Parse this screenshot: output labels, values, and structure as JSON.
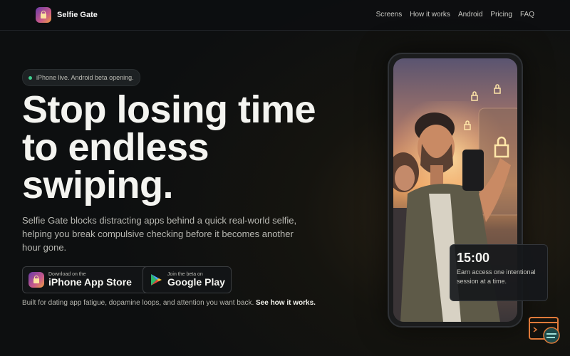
{
  "nav": {
    "brand": "Selfie Gate",
    "links": [
      "Screens",
      "How it works",
      "Android",
      "Pricing",
      "FAQ"
    ]
  },
  "hero": {
    "badge": "iPhone live. Android beta opening.",
    "headline_line1": "Stop losing time",
    "headline_line2": "to endless",
    "headline_line3": "swiping.",
    "subtext": "Selfie Gate blocks distracting apps behind a quick real-world selfie, helping you break compulsive checking before it becomes another hour gone."
  },
  "buttons": {
    "app_store_small": "Download on the",
    "app_store_big": "iPhone App Store",
    "play_small": "Join the beta on",
    "play_big": "Google Play"
  },
  "footer_note": {
    "text": "Built for dating app fatigue, dopamine loops, and attention you want back. ",
    "link": "See how it works."
  },
  "timer_card": {
    "time": "15:00",
    "description": "Earn access one intentional session at a time."
  },
  "colors": {
    "accent_green": "#3fcf8e",
    "widget_orange": "#e07a3a"
  }
}
